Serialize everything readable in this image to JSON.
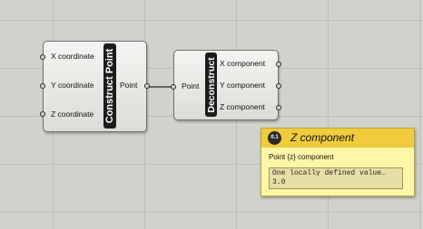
{
  "canvas": {
    "wires": [
      {
        "from": "construct-point.point",
        "to": "deconstruct.point"
      }
    ]
  },
  "construct_point": {
    "title": "Construct Point",
    "inputs": [
      "X coordinate",
      "Y coordinate",
      "Z coordinate"
    ],
    "output": "Point"
  },
  "deconstruct": {
    "title": "Deconstruct",
    "input": "Point",
    "outputs": [
      "X component",
      "Y component",
      "Z component"
    ]
  },
  "tooltip": {
    "icon_text": "0.1",
    "title": "Z component",
    "description": "Point {z} component",
    "value_line1": "One locally defined value…",
    "value_line2": "3.0",
    "colors": {
      "header": "#f0cb3c",
      "body": "#fff6a8"
    }
  }
}
